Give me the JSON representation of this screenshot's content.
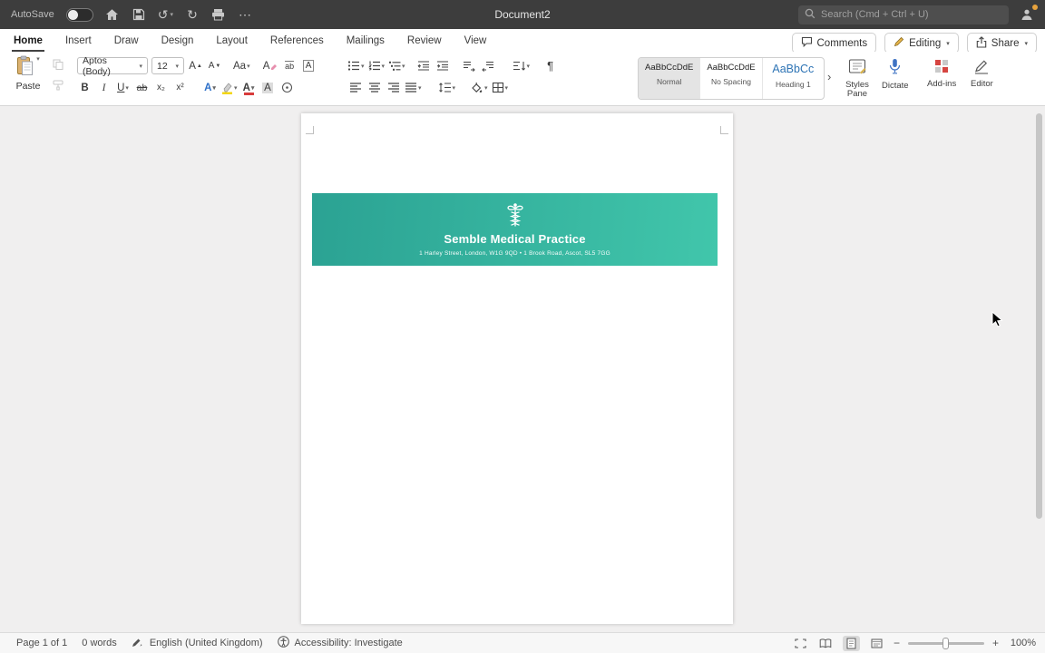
{
  "titlebar": {
    "autosave_label": "AutoSave",
    "document_title": "Document2",
    "search_placeholder": "Search (Cmd + Ctrl + U)"
  },
  "tabs": [
    {
      "label": "Home"
    },
    {
      "label": "Insert"
    },
    {
      "label": "Draw"
    },
    {
      "label": "Design"
    },
    {
      "label": "Layout"
    },
    {
      "label": "References"
    },
    {
      "label": "Mailings"
    },
    {
      "label": "Review"
    },
    {
      "label": "View"
    }
  ],
  "actions": {
    "comments": "Comments",
    "editing": "Editing",
    "share": "Share"
  },
  "ribbon": {
    "paste_label": "Paste",
    "font_name": "Aptos (Body)",
    "font_size": "12",
    "grow_font": "A",
    "shrink_font": "A",
    "change_case": "Aa",
    "clear_formatting": "A",
    "phonetic_guide": "ab",
    "char_border": "A",
    "bold": "B",
    "italic": "I",
    "underline": "U",
    "strikethrough": "ab",
    "subscript": "x₂",
    "superscript": "x²",
    "text_effects": "A",
    "font_color": "A",
    "char_shading": "A",
    "styles": [
      {
        "preview": "AaBbCcDdE",
        "name": "Normal"
      },
      {
        "preview": "AaBbCcDdE",
        "name": "No Spacing"
      },
      {
        "preview": "AaBbCc",
        "name": "Heading 1"
      }
    ],
    "styles_pane": "Styles Pane",
    "dictate": "Dictate",
    "addins": "Add-ins",
    "editor": "Editor"
  },
  "document": {
    "banner": {
      "practice_name": "Semble Medical Practice",
      "address_line": "1 Harley Street, London, W1G 9QD  •  1 Brook Road, Ascot, SL5 7GG",
      "gradient_start": "#2ba293",
      "gradient_end": "#41c6ab",
      "text_color": "#ffffff"
    }
  },
  "statusbar": {
    "page_info": "Page 1 of 1",
    "word_count": "0 words",
    "language": "English (United Kingdom)",
    "accessibility": "Accessibility: Investigate",
    "zoom_level": "100%"
  },
  "icons": {
    "chevron_down": "▾",
    "chevron_right": "›",
    "undo": "↺",
    "redo": "↻",
    "ellipsis": "⋯",
    "pilcrow": "¶",
    "minus": "−",
    "plus": "+"
  }
}
